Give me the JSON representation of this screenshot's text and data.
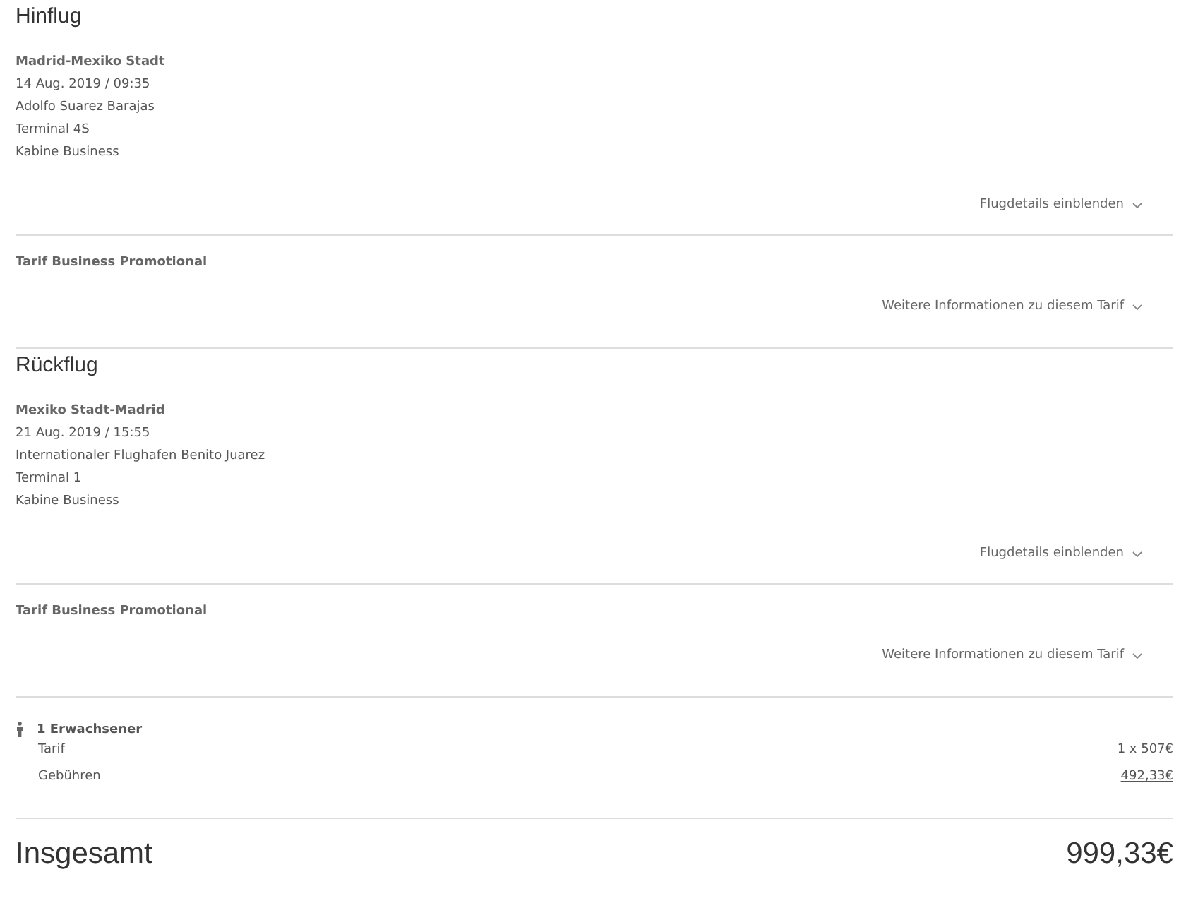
{
  "flights": [
    {
      "heading": "Hinflug",
      "route": "Madrid-Mexiko Stadt",
      "details": [
        "14 Aug. 2019 / 09:35",
        "Adolfo Suarez Barajas",
        "Terminal 4S",
        "Kabine Business"
      ],
      "details_toggle": "Flugdetails einblenden",
      "fare": "Tarif Business Promotional",
      "fare_toggle": "Weitere Informationen zu diesem Tarif"
    },
    {
      "heading": "Rückflug",
      "route": "Mexiko Stadt-Madrid",
      "details": [
        "21 Aug. 2019 / 15:55",
        "Internationaler Flughafen Benito Juarez",
        "Terminal 1",
        "Kabine Business"
      ],
      "details_toggle": "Flugdetails einblenden",
      "fare": "Tarif Business Promotional",
      "fare_toggle": "Weitere Informationen zu diesem Tarif"
    }
  ],
  "passengers": {
    "label": "1 Erwachsener",
    "rows": [
      {
        "label": "Tarif",
        "value": "1 x 507€",
        "kind": "text"
      },
      {
        "label": "Gebühren",
        "value": "492,33€",
        "kind": "link"
      }
    ]
  },
  "total": {
    "label": "Insgesamt",
    "value": "999,33€"
  }
}
